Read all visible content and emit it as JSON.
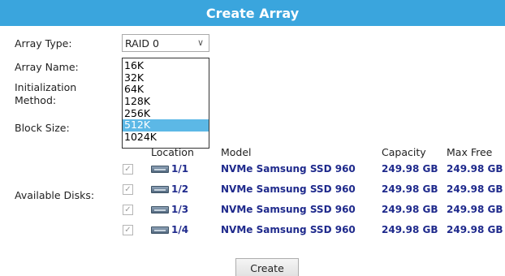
{
  "header": {
    "title": "Create Array"
  },
  "form": {
    "array_type_label": "Array Type:",
    "array_name_label": "Array Name:",
    "init_method_label_line1": "Initialization",
    "init_method_label_line2": "Method:",
    "block_size_label": "Block Size:",
    "available_disks_label": "Available Disks:",
    "array_type_value": "RAID 0",
    "block_size_options": [
      "16K",
      "32K",
      "64K",
      "128K",
      "256K",
      "512K",
      "1024K"
    ],
    "block_size_selected": "512K"
  },
  "disks": {
    "columns": {
      "location": "Location",
      "model": "Model",
      "capacity": "Capacity",
      "max_free": "Max Free"
    },
    "rows": [
      {
        "checked": true,
        "location": "1/1",
        "model": "NVMe Samsung SSD 960",
        "capacity": "249.98 GB",
        "max_free": "249.98 GB"
      },
      {
        "checked": true,
        "location": "1/2",
        "model": "NVMe Samsung SSD 960",
        "capacity": "249.98 GB",
        "max_free": "249.98 GB"
      },
      {
        "checked": true,
        "location": "1/3",
        "model": "NVMe Samsung SSD 960",
        "capacity": "249.98 GB",
        "max_free": "249.98 GB"
      },
      {
        "checked": true,
        "location": "1/4",
        "model": "NVMe Samsung SSD 960",
        "capacity": "249.98 GB",
        "max_free": "249.98 GB"
      }
    ]
  },
  "actions": {
    "create_label": "Create"
  },
  "colors": {
    "header_bg": "#3aa5dd",
    "selected_option_bg": "#5cb8e6",
    "disk_text": "#1f2a8c"
  },
  "icons": {
    "disk": "hard-disk-icon",
    "dropdown": "chevron-down-icon",
    "check": "checkmark-icon"
  }
}
